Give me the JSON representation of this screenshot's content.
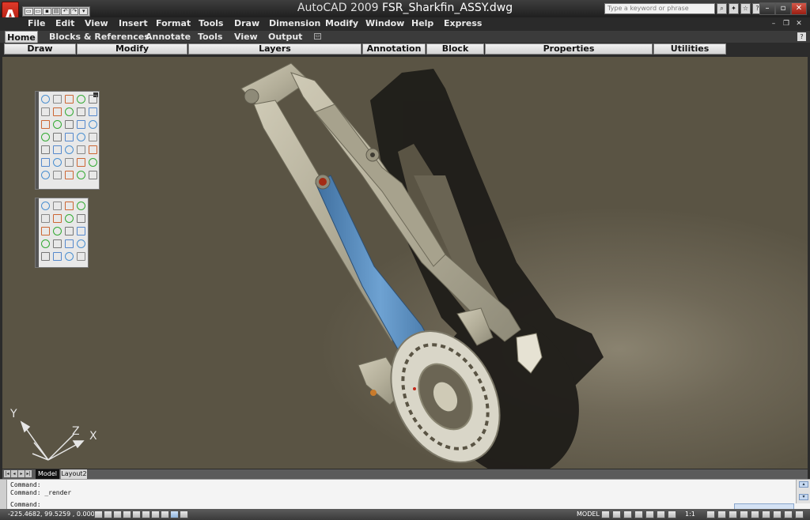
{
  "app": {
    "logo_letter": "A",
    "title_app": "AutoCAD 2009",
    "title_file": "FSR_Sharkfin_ASSY.dwg"
  },
  "search": {
    "placeholder": "Type a keyword or phrase"
  },
  "menu": [
    "File",
    "Edit",
    "View",
    "Insert",
    "Format",
    "Tools",
    "Draw",
    "Dimension",
    "Modify",
    "Window",
    "Help",
    "Express"
  ],
  "ribbon_tabs": [
    "Home",
    "Blocks & References",
    "Annotate",
    "Tools",
    "View",
    "Output"
  ],
  "ribbon_panels": [
    "Draw",
    "Modify",
    "Layers",
    "Annotation",
    "Block",
    "Properties",
    "Utilities"
  ],
  "ucs": {
    "x": "X",
    "y": "Y",
    "z": "Z"
  },
  "layout_tabs": [
    "Model",
    "Layout2"
  ],
  "command_lines": [
    "Command:",
    "Command:  _render",
    "Command:"
  ],
  "status": {
    "coordinates": "-225.4682, 99.5259 , 0.0000",
    "space": "MODEL",
    "annotation_scale": "1:1"
  },
  "colors": {
    "viewport_bg": "#6b6554",
    "frame_metal": "#bdb8a4",
    "link_blue": "#5d8fbf",
    "shadow": "#1f1d19"
  }
}
